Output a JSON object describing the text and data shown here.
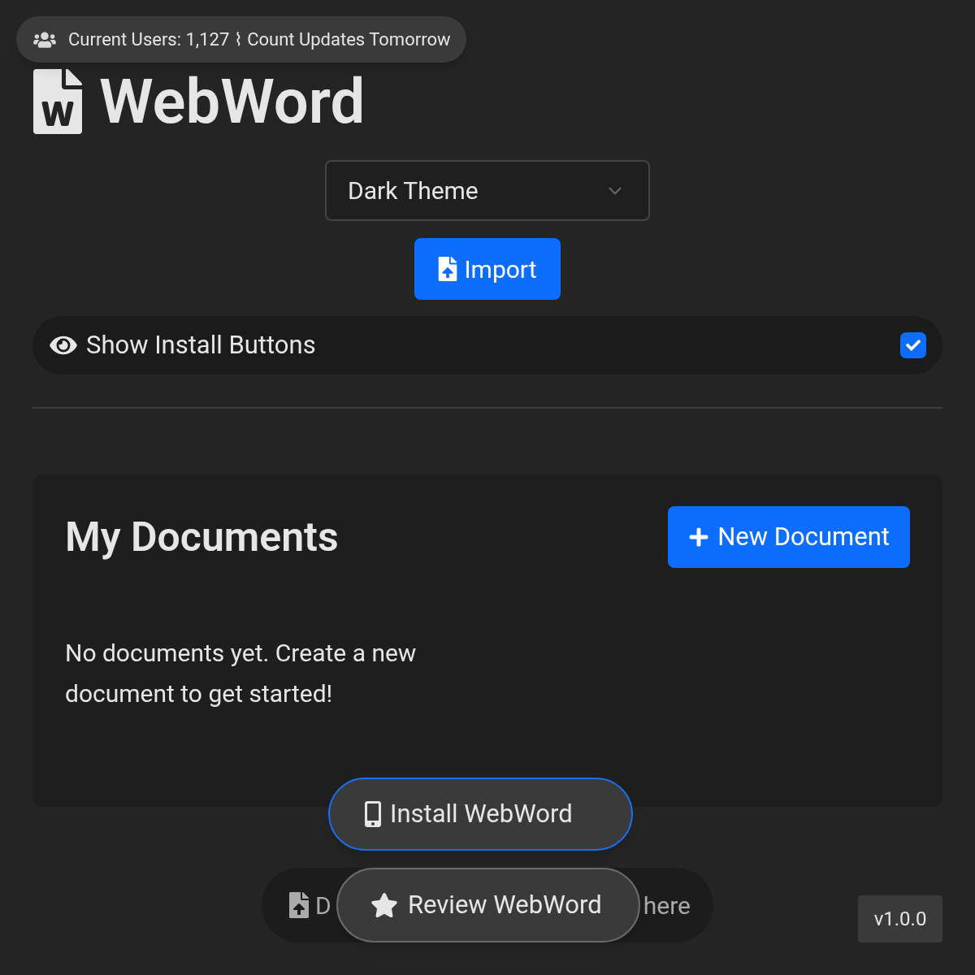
{
  "users_banner": {
    "text": "Current Users: 1,127 ⌇ Count Updates Tomorrow"
  },
  "app_title": "WebWord",
  "theme_select": {
    "value": "Dark Theme"
  },
  "import_button": "Import",
  "install_toggle": {
    "label": "Show Install Buttons",
    "checked": true
  },
  "documents": {
    "title": "My Documents",
    "new_button": "New Document",
    "empty_message": "No documents yet. Create a new document to get started!"
  },
  "install_button": "Install WebWord",
  "drop_zone": {
    "text_start": "D",
    "text_end": "here"
  },
  "review_button": "Review WebWord",
  "version": "v1.0.0"
}
